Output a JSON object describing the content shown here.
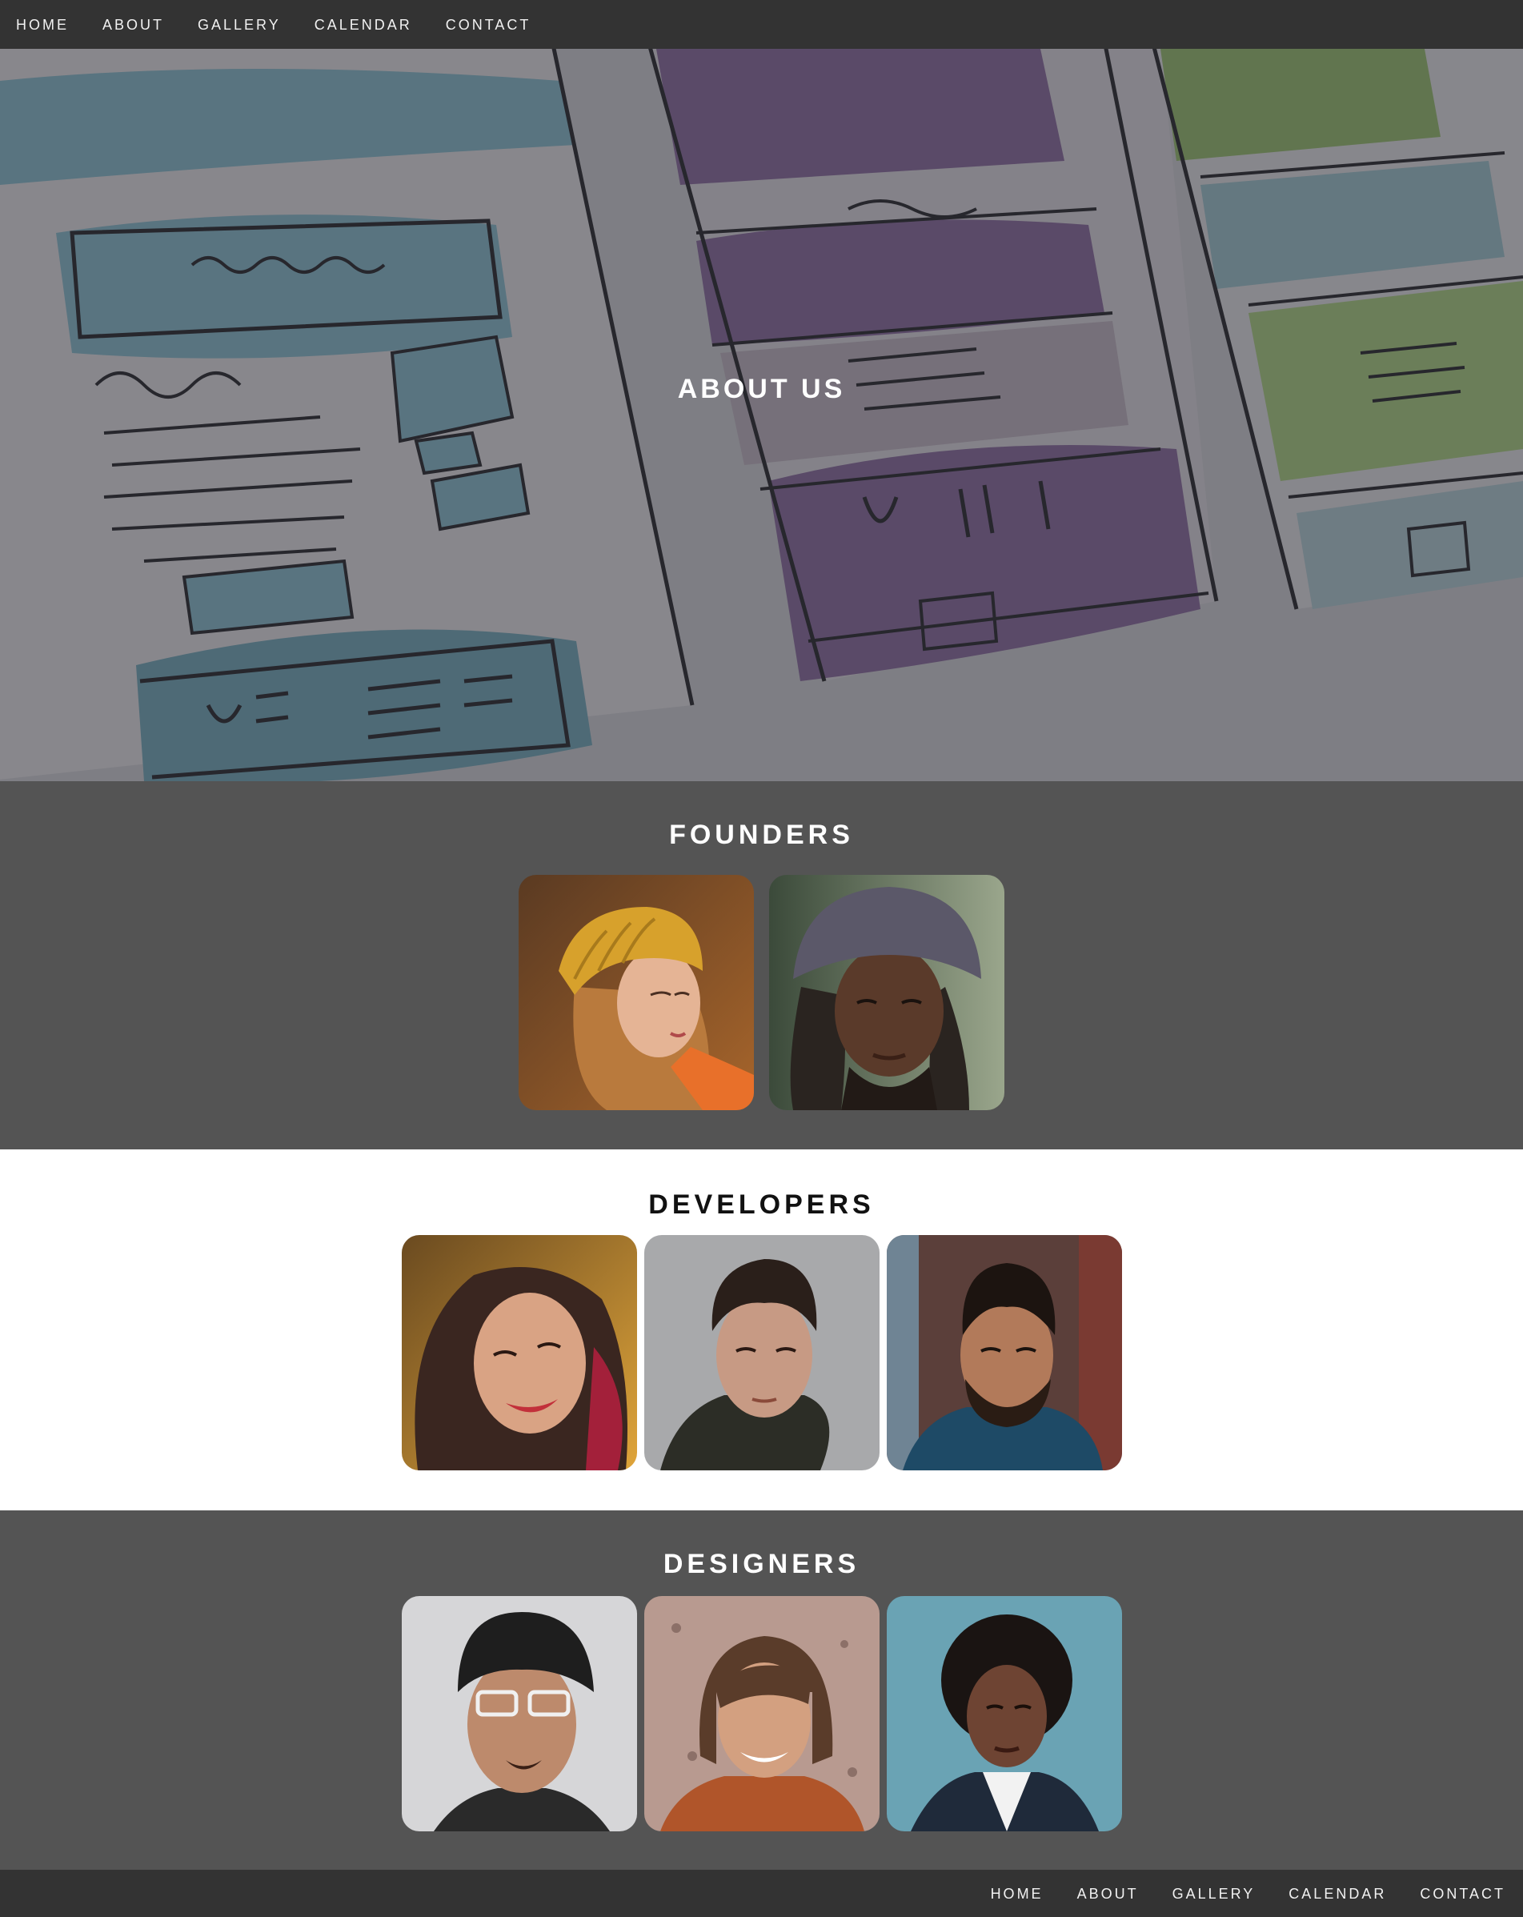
{
  "nav": {
    "items": [
      "HOME",
      "ABOUT",
      "GALLERY",
      "CALENDAR",
      "CONTACT"
    ]
  },
  "hero": {
    "title": "ABOUT US"
  },
  "founders": {
    "title": "FOUNDERS",
    "people": [
      {
        "photo": "woman-yellow-beanie"
      },
      {
        "photo": "man-bucket-hat"
      }
    ]
  },
  "developers": {
    "title": "DEVELOPERS",
    "people": [
      {
        "photo": "woman-curly-hair"
      },
      {
        "photo": "man-quiff"
      },
      {
        "photo": "man-beard"
      }
    ]
  },
  "designers": {
    "title": "DESIGNERS",
    "people": [
      {
        "photo": "man-glasses-beanie"
      },
      {
        "photo": "woman-bob-hair"
      },
      {
        "photo": "woman-afro"
      }
    ]
  },
  "footer": {
    "items": [
      "HOME",
      "ABOUT",
      "GALLERY",
      "CALENDAR",
      "CONTACT"
    ]
  },
  "colors": {
    "nav_bg": "#333333",
    "section_dark": "#545454",
    "section_light": "#ffffff"
  }
}
